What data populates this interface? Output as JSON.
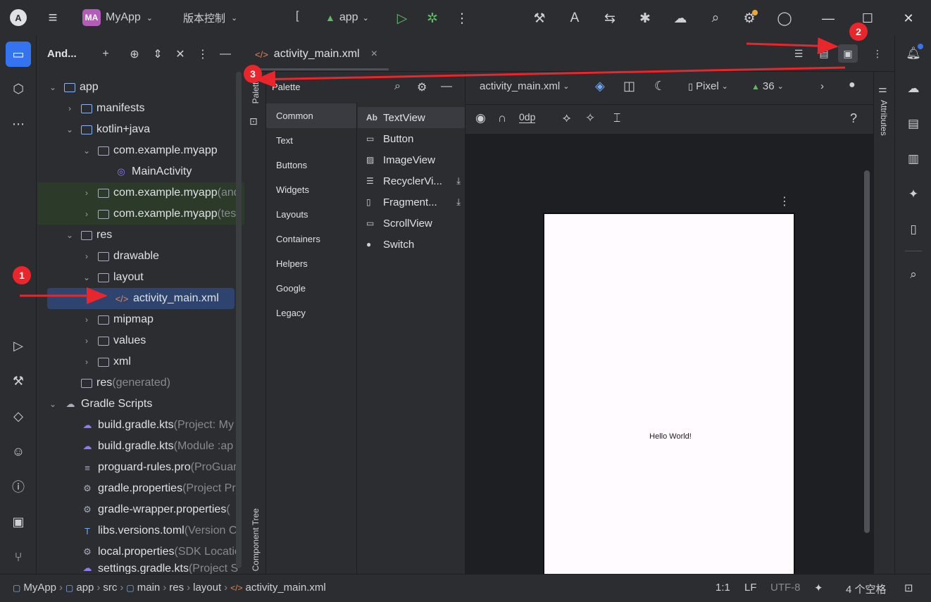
{
  "titlebar": {
    "logo": "A",
    "project_badge": "MA",
    "project_name": "MyApp",
    "vcs": "版本控制",
    "bracket": "[",
    "run_config": "app"
  },
  "project_panel": {
    "title": "And...",
    "tree": [
      {
        "label": "app",
        "suffix": ""
      },
      {
        "label": "manifests",
        "suffix": ""
      },
      {
        "label": "kotlin+java",
        "suffix": ""
      },
      {
        "label": "com.example.myapp",
        "suffix": ""
      },
      {
        "label": "MainActivity",
        "suffix": ""
      },
      {
        "label": "com.example.myapp",
        "suffix": " (and"
      },
      {
        "label": "com.example.myapp",
        "suffix": " (tes"
      },
      {
        "label": "res",
        "suffix": ""
      },
      {
        "label": "drawable",
        "suffix": ""
      },
      {
        "label": "layout",
        "suffix": ""
      },
      {
        "label": "activity_main.xml",
        "suffix": ""
      },
      {
        "label": "mipmap",
        "suffix": ""
      },
      {
        "label": "values",
        "suffix": ""
      },
      {
        "label": "xml",
        "suffix": ""
      },
      {
        "label": "res",
        "suffix": " (generated)"
      },
      {
        "label": "Gradle Scripts",
        "suffix": ""
      },
      {
        "label": "build.gradle.kts",
        "suffix": " (Project: My"
      },
      {
        "label": "build.gradle.kts",
        "suffix": " (Module :ap"
      },
      {
        "label": "proguard-rules.pro",
        "suffix": " (ProGuar"
      },
      {
        "label": "gradle.properties",
        "suffix": " (Project Pr"
      },
      {
        "label": "gradle-wrapper.properties",
        "suffix": " ("
      },
      {
        "label": "libs.versions.toml",
        "suffix": " (Version C"
      },
      {
        "label": "local.properties",
        "suffix": " (SDK Locatio"
      },
      {
        "label": "settings.gradle.kts",
        "suffix": " (Project S"
      }
    ]
  },
  "editor": {
    "tab_label": "activity_main.xml",
    "tab_close": "×"
  },
  "palette": {
    "side_label": "Palette",
    "component_tree_label": "Component Tree",
    "title": "Palette",
    "categories": [
      "Common",
      "Text",
      "Buttons",
      "Widgets",
      "Layouts",
      "Containers",
      "Helpers",
      "Google",
      "Legacy"
    ],
    "items": [
      {
        "icon": "Ab",
        "label": "TextView"
      },
      {
        "icon": "▭",
        "label": "Button"
      },
      {
        "icon": "▨",
        "label": "ImageView"
      },
      {
        "icon": "☰",
        "label": "RecyclerVi..."
      },
      {
        "icon": "▯",
        "label": "Fragment..."
      },
      {
        "icon": "▭",
        "label": "ScrollView"
      },
      {
        "icon": "●",
        "label": "Switch"
      }
    ]
  },
  "design": {
    "file_selector": "activity_main.xml",
    "device": "Pixel",
    "api": "36",
    "margin": "0dp",
    "help": "?",
    "preview_text": "Hello World!"
  },
  "attributes_label": "Attributes",
  "statusbar": {
    "crumbs": [
      "MyApp",
      "app",
      "src",
      "main",
      "res",
      "layout",
      "activity_main.xml"
    ],
    "position": "1:1",
    "line_ending": "LF",
    "encoding": "UTF-8",
    "indent": "4 个空格"
  },
  "annotations": [
    "1",
    "2",
    "3"
  ],
  "colors": {
    "accent": "#3574f0",
    "marker": "#e8262b",
    "selection": "#2e436e"
  }
}
